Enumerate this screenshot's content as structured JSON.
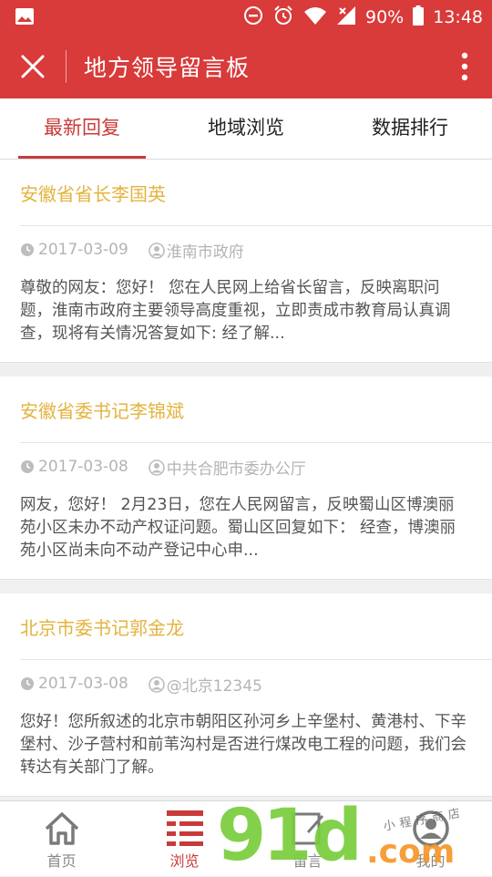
{
  "status_bar": {
    "battery": "90%",
    "time": "13:48"
  },
  "app_bar": {
    "title": "地方领导留言板"
  },
  "tabs": [
    {
      "label": "最新回复",
      "active": true
    },
    {
      "label": "地域浏览",
      "active": false
    },
    {
      "label": "数据排行",
      "active": false
    }
  ],
  "messages": [
    {
      "title": "安徽省省长李国英",
      "date": "2017-03-09",
      "author": "淮南市政府",
      "body": "尊敬的网友：您好！ 您在人民网上给省长留言，反映离职问题，淮南市政府主要领导高度重视，立即责成市教育局认真调查，现将有关情况答复如下: 经了解..."
    },
    {
      "title": "安徽省委书记李锦斌",
      "date": "2017-03-08",
      "author": "中共合肥市委办公厅",
      "body": "网友，您好！ 2月23日，您在人民网留言，反映蜀山区博澳丽苑小区未办不动产权证问题。蜀山区回复如下：  经查，博澳丽苑小区尚未向不动产登记中心申..."
    },
    {
      "title": "北京市委书记郭金龙",
      "date": "2017-03-08",
      "author": "@北京12345",
      "body": "您好！您所叙述的北京市朝阳区孙河乡上辛堡村、黄港村、下辛堡村、沙子营村和前苇沟村是否进行煤改电工程的问题，我们会转达有关部门了解。"
    }
  ],
  "bottom_nav": [
    {
      "label": "首页",
      "icon": "home-icon",
      "active": false
    },
    {
      "label": "浏览",
      "icon": "list-icon",
      "active": true
    },
    {
      "label": "留言",
      "icon": "edit-icon",
      "active": false
    },
    {
      "label": "我的",
      "icon": "user-icon",
      "active": false
    }
  ],
  "watermark": {
    "brand": "91",
    "brand2": "d",
    "domain": ".com",
    "tagline": "小程序商店"
  },
  "colors": {
    "primary": "#d93a3a",
    "accent_title": "#e3b33e",
    "active_tab": "#c83a3a"
  }
}
